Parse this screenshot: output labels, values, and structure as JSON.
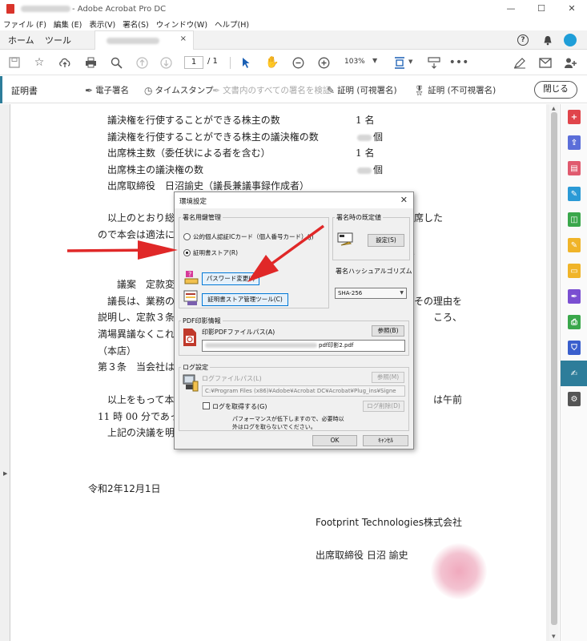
{
  "window": {
    "title": "- Adobe Acrobat Pro DC",
    "controls": [
      "—",
      "☐",
      "✕"
    ]
  },
  "menu": [
    "ファイル (F)",
    "編集 (E)",
    "表示(V)",
    "署名(S)",
    "ウィンドウ(W)",
    "ヘルプ(H)"
  ],
  "tabs": {
    "home": "ホーム",
    "tools": "ツール",
    "close": "×"
  },
  "toolbar": {
    "page_current": "1",
    "page_total": "/ 1",
    "zoom": "103%"
  },
  "cert_bar": {
    "title": "証明書",
    "digital_sign": "電子署名",
    "timestamp": "タイムスタンプ",
    "verify_all": "文書内のすべての署名を検証",
    "certify_visible": "証明 (可視署名)",
    "certify_invisible": "証明 (不可視署名)",
    "close": "閉じる"
  },
  "document": {
    "lines": [
      {
        "label": "議決権を行使することができる株主の数",
        "value": "1 名",
        "blurred": false
      },
      {
        "label": "議決権を行使することができる株主の議決権の数",
        "value": "個",
        "blurred": true
      },
      {
        "label": "出席株主数（委任状による者を含む）",
        "value": "1 名",
        "blurred": false
      },
      {
        "label": "出席株主の議決権の数",
        "value": "個",
        "blurred": true
      },
      {
        "label": "出席取締役　日沼諭史（議長兼議事録作成者）",
        "value": "",
        "blurred": false
      }
    ],
    "para1_a": "以上のとおり総",
    "para1_b": "席した",
    "para2": "ので本会は適法に",
    "para2_end": "。",
    "agenda": "議案　定款変",
    "chair_a": "議長は、業務の",
    "chair_b": "その理由を",
    "desc_a": "説明し、定款３条",
    "desc_b": "ころ、",
    "unanimous": "満場異議なくこれ",
    "head_office": "（本店）",
    "article": "第３条　当会社は",
    "closing_a": "以上をもって本",
    "closing_b": "は午前",
    "time": "11 時 00 分であっ",
    "resolution": "上記の決議を明",
    "date": "令和2年12月1日",
    "company": "Footprint Technologies株式会社",
    "signer": "出席取締役 日沼 諭史"
  },
  "dialog": {
    "title": "環境設定",
    "close": "✕",
    "sig_mgmt": {
      "label": "署名用鍵管理",
      "radio_mynumber": "公的個人認証ICカード（個人番号カード）(J)",
      "radio_store": "証明書ストア(R)",
      "selected": "store",
      "password_button": "パスワード変更(I)",
      "store_tool_button": "証明書ストア管理ツール(C)"
    },
    "default_sign": {
      "label": "署名時の既定値",
      "settings_button": "設定(S)"
    },
    "hash": {
      "label": "署名ハッシュアルゴリズム",
      "value": "SHA-256"
    },
    "pdf_stamp": {
      "label": "PDF印影情報",
      "path_label": "印影PDFファイルパス(A)",
      "browse_button": "参照(B)",
      "path_value": "pdf印影2.pdf"
    },
    "log": {
      "label": "ログ設定",
      "path_label": "ログファイルパス(L)",
      "browse_button": "参照(M)",
      "path_value": "C:¥Program Files (x86)¥Adobe¥Acrobat DC¥Acrobat¥Plug_ins¥Signe",
      "checkbox_label": "ログを取得する(G)",
      "delete_button": "ログ削除(D)",
      "note_line1": "パフォーマンスが低下しますので、必要時以",
      "note_line2": "外はログを取らないでください。"
    },
    "ok": "OK",
    "cancel": "ｷｬﾝｾﾙ"
  },
  "colors": {
    "accent": "#2d7d9a",
    "arrow": "#e02828",
    "stamp": "#f0a9bd"
  },
  "sidebar_icons": [
    "create-pdf-icon",
    "export-pdf-icon",
    "organize-pages-icon",
    "edit-pdf-icon",
    "combine-icon",
    "comment-icon",
    "fill-sign-icon",
    "print-production-icon",
    "protect-icon",
    "certificates-icon",
    "more-tools-icon"
  ]
}
